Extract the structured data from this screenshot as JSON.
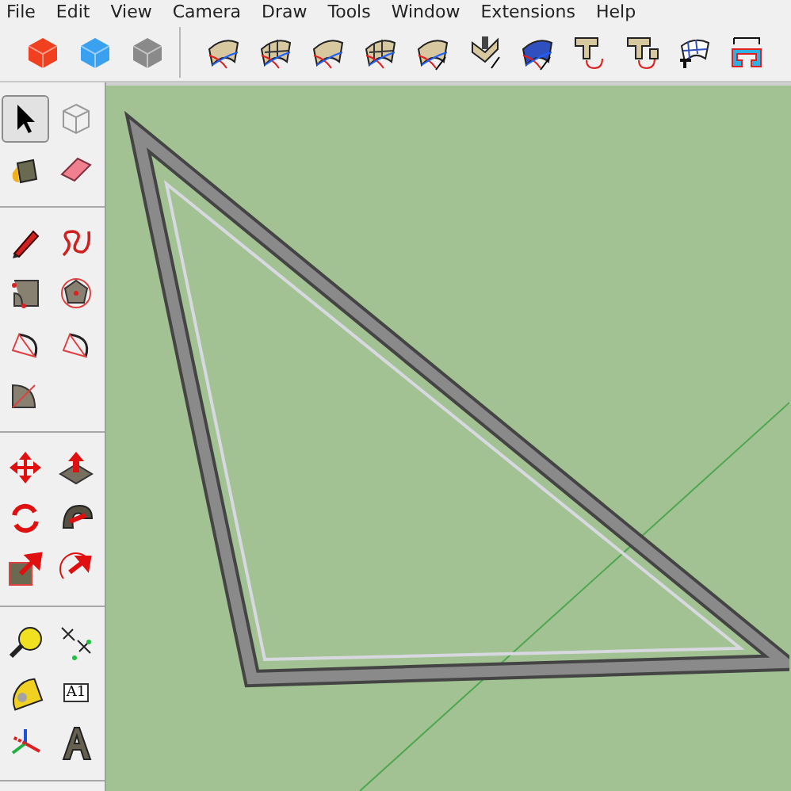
{
  "menu": [
    "File",
    "Edit",
    "View",
    "Camera",
    "Draw",
    "Tools",
    "Window",
    "Extensions",
    "Help"
  ],
  "toolbar": [
    {
      "kind": "cube",
      "color": "#f04020"
    },
    {
      "kind": "cube",
      "color": "#3aa0f0"
    },
    {
      "kind": "cube",
      "color": "#8a8a8a"
    },
    {
      "kind": "separator"
    },
    {
      "kind": "surface"
    },
    {
      "kind": "mesh"
    },
    {
      "kind": "contour"
    },
    {
      "kind": "grid"
    },
    {
      "kind": "half"
    },
    {
      "kind": "fold"
    },
    {
      "kind": "halfblue"
    },
    {
      "kind": "tee"
    },
    {
      "kind": "teebox"
    },
    {
      "kind": "meshtee"
    },
    {
      "kind": "channel"
    }
  ],
  "tool_palette": [
    [
      {
        "kind": "select",
        "selected": true
      },
      {
        "kind": "component",
        "selected": false
      },
      {
        "kind": "paint",
        "selected": false
      },
      {
        "kind": "eraser",
        "selected": false
      }
    ],
    [
      {
        "kind": "pencil",
        "selected": false
      },
      {
        "kind": "freehand",
        "selected": false
      },
      {
        "kind": "rectangle",
        "selected": false
      },
      {
        "kind": "polygon",
        "selected": false
      },
      {
        "kind": "arc",
        "selected": false
      },
      {
        "kind": "arc",
        "selected": false
      },
      {
        "kind": "pie",
        "selected": false
      }
    ],
    [
      {
        "kind": "move",
        "selected": false
      },
      {
        "kind": "pushpull",
        "selected": false
      },
      {
        "kind": "rotate",
        "selected": false
      },
      {
        "kind": "followme",
        "selected": false
      },
      {
        "kind": "scale",
        "selected": false
      },
      {
        "kind": "offset",
        "selected": false
      }
    ],
    [
      {
        "kind": "tape",
        "selected": false
      },
      {
        "kind": "dimension",
        "selected": false
      },
      {
        "kind": "protractor",
        "selected": false
      },
      {
        "kind": "text",
        "selected": false,
        "label": "A1"
      },
      {
        "kind": "axes",
        "selected": false
      },
      {
        "kind": "text3d",
        "selected": false
      }
    ]
  ]
}
